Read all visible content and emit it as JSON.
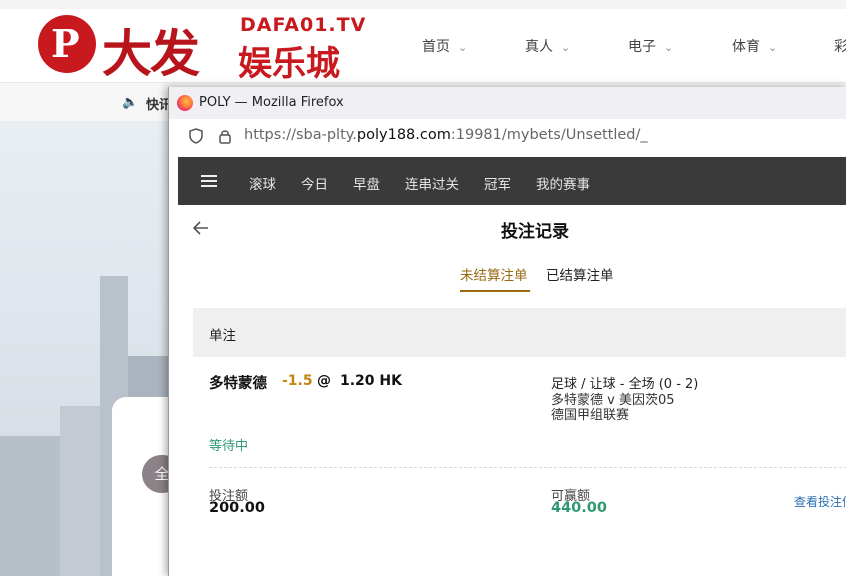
{
  "site": {
    "logo_glyph": "P",
    "logo_cn": "大发",
    "logo_domain": "DAFA01.TV",
    "logo_sub": "娱乐城",
    "nav": [
      {
        "label": "首页"
      },
      {
        "label": "真人"
      },
      {
        "label": "电子"
      },
      {
        "label": "体育"
      },
      {
        "label": "彩"
      }
    ],
    "notice_label": "快讯",
    "card_pill": "全"
  },
  "browser": {
    "title": "POLY — Mozilla Firefox",
    "url_prefix": "https://sba-plty.",
    "url_host": "poly188.com",
    "url_suffix": ":19981/mybets/Unsettled/_"
  },
  "app": {
    "tabs": [
      "滚球",
      "今日",
      "早盘",
      "连串过关",
      "冠军",
      "我的赛事"
    ],
    "page_title": "投注记录",
    "subtab_active": "未结算注单",
    "subtab_inactive": "已结算注单",
    "section_label": "单注"
  },
  "bet": {
    "team": "多特蒙德",
    "handicap": "-1.5",
    "at": "@",
    "odds": "1.20 HK",
    "market": "足球 / 让球 - 全场 (0 - 2)",
    "match": "多特蒙德 v 美因茨05",
    "league": "德国甲组联赛",
    "status": "等待中",
    "stake_label": "投注额",
    "stake_value": "200.00",
    "win_label": "可赢额",
    "win_value": "440.00",
    "detail_link": "查看投注信"
  },
  "colors": {
    "brand_red": "#c8191e",
    "accent_gold": "#9a6a13",
    "handicap_orange": "#c3860f",
    "win_green": "#2f9a72",
    "nav_dark": "#3a3a3a"
  }
}
